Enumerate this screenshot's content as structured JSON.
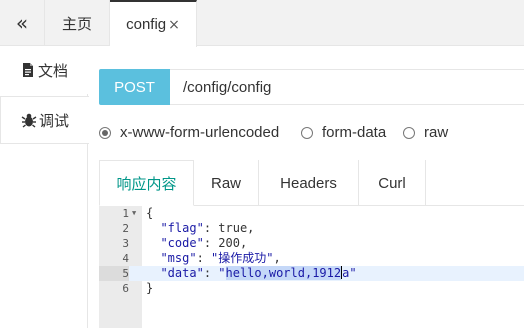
{
  "topbar": {
    "collapse_icon": "«",
    "tabs": [
      {
        "label": "主页"
      },
      {
        "label": "config",
        "close": "×"
      }
    ]
  },
  "sidebar": {
    "items": [
      {
        "label": "文档",
        "icon": "document-icon"
      },
      {
        "label": "调试",
        "icon": "bug-icon"
      }
    ]
  },
  "request": {
    "method": "POST",
    "url": "/config/config"
  },
  "body_type": {
    "options": [
      "x-www-form-urlencoded",
      "form-data",
      "raw"
    ],
    "selected": "x-www-form-urlencoded"
  },
  "response": {
    "tabs": [
      "响应内容",
      "Raw",
      "Headers",
      "Curl"
    ],
    "active_tab": "响应内容",
    "code": {
      "line_numbers": [
        "1",
        "2",
        "3",
        "4",
        "5",
        "6"
      ],
      "open_brace": "{",
      "close_brace": "}",
      "flag_key": "\"flag\"",
      "flag_value": "true",
      "code_key": "\"code\"",
      "code_value": "200",
      "msg_key": "\"msg\"",
      "msg_value": "\"操作成功\"",
      "data_key": "\"data\"",
      "data_value_selected": "hello,world,1912",
      "data_value_rest": "a\"",
      "data_value_open_quote": "\""
    }
  },
  "colors": {
    "method_bg": "#5bc0de",
    "active_tab_text": "#009688",
    "gutter_bg": "#ebebeb",
    "active_line_bg": "#e8f2fe"
  }
}
